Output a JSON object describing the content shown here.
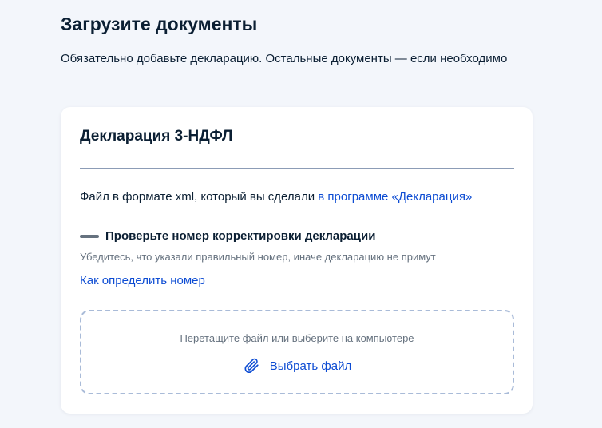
{
  "page": {
    "title": "Загрузите документы",
    "subtitle": "Обязательно добавьте декларацию. Остальные документы — если необходимо"
  },
  "card": {
    "title": "Декларация 3-НДФЛ",
    "description_prefix": "Файл в формате xml, который вы сделали ",
    "description_link": "в программе «Декларация»",
    "warning_title": "Проверьте номер корректировки декларации",
    "warning_text": "Убедитесь, что указали правильный номер, иначе декларацию не примут",
    "help_link": "Как определить номер",
    "dropzone": {
      "hint": "Перетащите файл или выберите на компьютере",
      "button_label": "Выбрать файл",
      "icon": "paperclip-icon"
    }
  },
  "colors": {
    "background": "#f3f6fb",
    "card": "#ffffff",
    "text": "#0b1f33",
    "secondary_text": "#66727f",
    "link": "#0d4cd3",
    "divider": "#8c9cb6",
    "dropzone_border": "#a9bbd8"
  }
}
